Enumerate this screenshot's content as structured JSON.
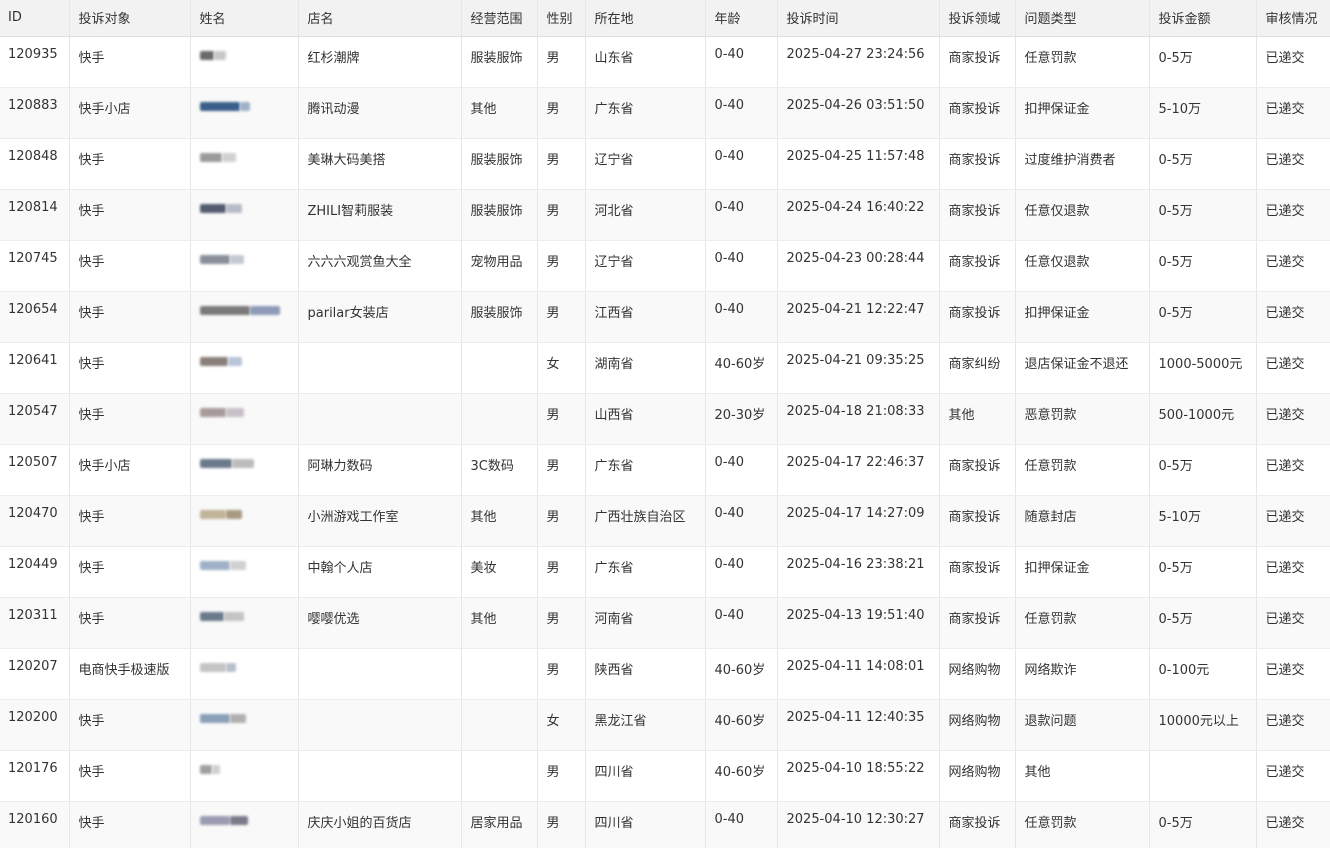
{
  "table": {
    "headers": [
      "ID",
      "投诉对象",
      "姓名",
      "店名",
      "经营范围",
      "性别",
      "所在地",
      "年龄",
      "投诉时间",
      "投诉领域",
      "问题类型",
      "投诉金额",
      "审核情况"
    ],
    "rows": [
      [
        "120935",
        "快手",
        "",
        "红杉潮牌",
        "服装服饰",
        "男",
        "山东省",
        "0-40",
        "2025-04-27 23:24:56",
        "商家投诉",
        "任意罚款",
        "0-5万",
        "已递交"
      ],
      [
        "120883",
        "快手小店",
        "",
        "腾讯动漫",
        "其他",
        "男",
        "广东省",
        "0-40",
        "2025-04-26 03:51:50",
        "商家投诉",
        "扣押保证金",
        "5-10万",
        "已递交"
      ],
      [
        "120848",
        "快手",
        "",
        "美琳大码美搭",
        "服装服饰",
        "男",
        "辽宁省",
        "0-40",
        "2025-04-25 11:57:48",
        "商家投诉",
        "过度维护消费者",
        "0-5万",
        "已递交"
      ],
      [
        "120814",
        "快手",
        "",
        "ZHILI智莉服装",
        "服装服饰",
        "男",
        "河北省",
        "0-40",
        "2025-04-24 16:40:22",
        "商家投诉",
        "任意仅退款",
        "0-5万",
        "已递交"
      ],
      [
        "120745",
        "快手",
        "",
        "六六六观赏鱼大全",
        "宠物用品",
        "男",
        "辽宁省",
        "0-40",
        "2025-04-23 00:28:44",
        "商家投诉",
        "任意仅退款",
        "0-5万",
        "已递交"
      ],
      [
        "120654",
        "快手",
        "",
        "parilar女装店",
        "服装服饰",
        "男",
        "江西省",
        "0-40",
        "2025-04-21 12:22:47",
        "商家投诉",
        "扣押保证金",
        "0-5万",
        "已递交"
      ],
      [
        "120641",
        "快手",
        "",
        "",
        "",
        "女",
        "湖南省",
        "40-60岁",
        "2025-04-21 09:35:25",
        "商家纠纷",
        "退店保证金不退还",
        "1000-5000元",
        "已递交"
      ],
      [
        "120547",
        "快手",
        "",
        "",
        "",
        "男",
        "山西省",
        "20-30岁",
        "2025-04-18 21:08:33",
        "其他",
        "恶意罚款",
        "500-1000元",
        "已递交"
      ],
      [
        "120507",
        "快手小店",
        "",
        "阿琳力数码",
        "3C数码",
        "男",
        "广东省",
        "0-40",
        "2025-04-17 22:46:37",
        "商家投诉",
        "任意罚款",
        "0-5万",
        "已递交"
      ],
      [
        "120470",
        "快手",
        "",
        "小洲游戏工作室",
        "其他",
        "男",
        "广西壮族自治区",
        "0-40",
        "2025-04-17 14:27:09",
        "商家投诉",
        "随意封店",
        "5-10万",
        "已递交"
      ],
      [
        "120449",
        "快手",
        "",
        "中翰个人店",
        "美妆",
        "男",
        "广东省",
        "0-40",
        "2025-04-16 23:38:21",
        "商家投诉",
        "扣押保证金",
        "0-5万",
        "已递交"
      ],
      [
        "120311",
        "快手",
        "",
        "嘤嘤优选",
        "其他",
        "男",
        "河南省",
        "0-40",
        "2025-04-13 19:51:40",
        "商家投诉",
        "任意罚款",
        "0-5万",
        "已递交"
      ],
      [
        "120207",
        "电商快手极速版",
        "",
        "",
        "",
        "男",
        "陕西省",
        "40-60岁",
        "2025-04-11 14:08:01",
        "网络购物",
        "网络欺诈",
        "0-100元",
        "已递交"
      ],
      [
        "120200",
        "快手",
        "",
        "",
        "",
        "女",
        "黑龙江省",
        "40-60岁",
        "2025-04-11 12:40:35",
        "网络购物",
        "退款问题",
        "10000元以上",
        "已递交"
      ],
      [
        "120176",
        "快手",
        "",
        "",
        "",
        "男",
        "四川省",
        "40-60岁",
        "2025-04-10 18:55:22",
        "网络购物",
        "其他",
        "",
        "已递交"
      ],
      [
        "120160",
        "快手",
        "",
        "庆庆小姐的百货店",
        "居家用品",
        "男",
        "四川省",
        "0-40",
        "2025-04-10 12:30:27",
        "商家投诉",
        "任意罚款",
        "0-5万",
        "已递交"
      ]
    ]
  },
  "colors": {
    "header_bg": "#f2f2f2",
    "row_alt_bg": "#f9f9f9",
    "border": "#e6e6e6",
    "text": "#333333"
  }
}
